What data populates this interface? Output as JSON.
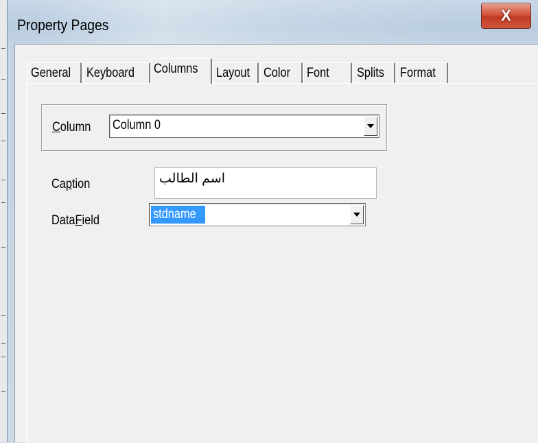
{
  "dialog": {
    "title": "Property Pages",
    "close_label": "X"
  },
  "tabs": [
    {
      "label": "General"
    },
    {
      "label": "Keyboard"
    },
    {
      "label": "Columns",
      "active": true
    },
    {
      "label": "Layout"
    },
    {
      "label": "Color"
    },
    {
      "label": "Font"
    },
    {
      "label": "Splits"
    },
    {
      "label": "Format"
    }
  ],
  "columns_page": {
    "column": {
      "label_pre": "",
      "label_accel": "C",
      "label_post": "olumn",
      "value": "Column 0"
    },
    "caption": {
      "label_pre": "Ca",
      "label_accel": "p",
      "label_post": "tion",
      "value": "اسم الطالب"
    },
    "datafield": {
      "label_pre": "Data",
      "label_accel": "F",
      "label_post": "ield",
      "value": "stdname"
    }
  }
}
